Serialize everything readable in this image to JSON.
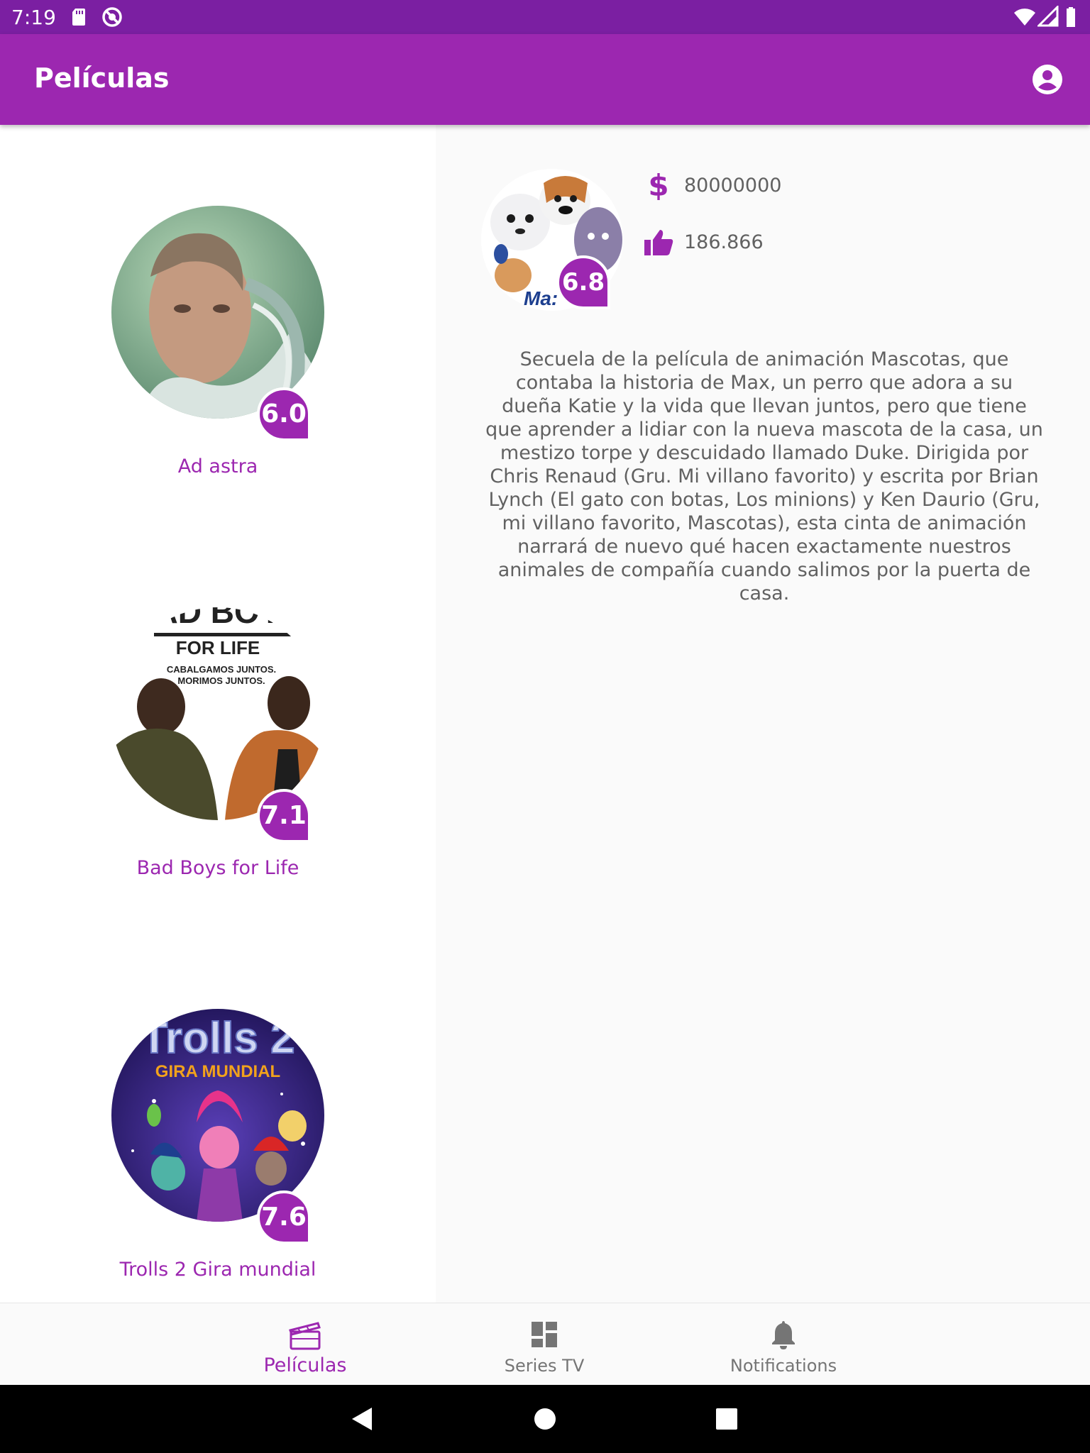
{
  "status_bar": {
    "time": "7:19",
    "icons": [
      "sd-card-icon",
      "block-icon",
      "wifi-icon",
      "signal-icon",
      "battery-icon"
    ]
  },
  "app_bar": {
    "title": "Películas",
    "account_icon": "account-circle-icon",
    "background": "#9c27b0"
  },
  "movies": [
    {
      "title": "Ad astra",
      "rating": "6.0"
    },
    {
      "title": "Bad Boys for Life",
      "rating": "7.1"
    },
    {
      "title": "Trolls 2 Gira mundial",
      "rating": "7.6"
    }
  ],
  "poster_text": {
    "bad_boys_top": "AD BOY",
    "bad_boys_sub": "FOR LIFE",
    "bad_boys_tag1": "CABALGAMOS JUNTOS.",
    "bad_boys_tag2": "MORIMOS JUNTOS.",
    "trolls_title": "Trolls 2",
    "trolls_sub": "GIRA MUNDIAL",
    "pets_logo": "Ma:"
  },
  "detail": {
    "rating": "6.8",
    "budget_icon": "dollar-icon",
    "budget": "80000000",
    "popularity_icon": "thumb-up-icon",
    "popularity": "186.866",
    "overview": "Secuela de la película de animación Mascotas, que contaba la historia de Max, un perro que adora a su dueña Katie y la vida que llevan juntos, pero que tiene que aprender a lidiar con la nueva mascota de la casa, un mestizo torpe y descuidado llamado Duke.  Dirigida por Chris Renaud (Gru. Mi villano favorito) y escrita por Brian Lynch (El gato con botas, Los minions) y Ken Daurio (Gru, mi villano favorito, Mascotas), esta cinta de animación narrará de nuevo qué hacen exactamente nuestros animales de compañía cuando salimos por la puerta de casa."
  },
  "bottom_nav": {
    "items": [
      {
        "label": "Películas",
        "icon": "movie-clapperboard-icon",
        "active": true
      },
      {
        "label": "Series TV",
        "icon": "dashboard-icon",
        "active": false
      },
      {
        "label": "Notifications",
        "icon": "bell-icon",
        "active": false
      }
    ]
  },
  "system_nav": {
    "icons": [
      "back-icon",
      "home-icon",
      "recents-icon"
    ]
  },
  "colors": {
    "primary": "#9c27b0",
    "primary_dark": "#7b1fa2",
    "text_secondary": "#616161"
  }
}
